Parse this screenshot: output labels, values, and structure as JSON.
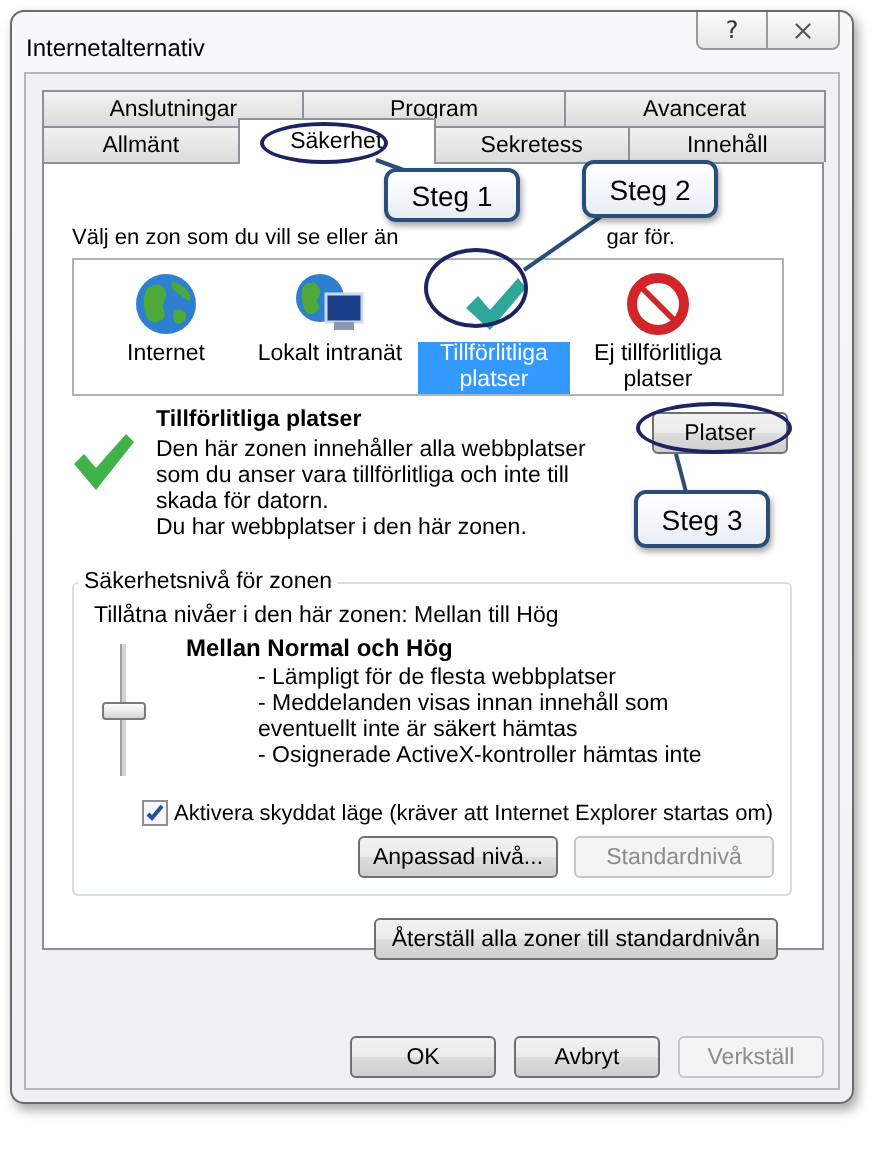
{
  "window": {
    "title": "Internetalternativ",
    "help": "?"
  },
  "tab_rows": [
    {
      "tabs": [
        {
          "label": "Anslutningar",
          "selected": false
        },
        {
          "label": "Program",
          "selected": false
        },
        {
          "label": "Avancerat",
          "selected": false
        }
      ]
    },
    {
      "tabs": [
        {
          "label": "Allmänt",
          "selected": false
        },
        {
          "label": "Säkerhet",
          "selected": true
        },
        {
          "label": "Sekretess",
          "selected": false
        },
        {
          "label": "Innehåll",
          "selected": false
        }
      ]
    }
  ],
  "instruction": {
    "before": "Välj en zon som du vill se eller än",
    "after": "gar för."
  },
  "zones": [
    {
      "kind": "globe",
      "label": "Internet",
      "selected": false
    },
    {
      "kind": "intranet",
      "label": "Lokalt intranät",
      "selected": false
    },
    {
      "kind": "trusted",
      "label": "Tillförlitliga platser",
      "selected": true
    },
    {
      "kind": "blocked",
      "label": "Ej tillförlitliga platser",
      "selected": false
    }
  ],
  "zone_info": {
    "title": "Tillförlitliga platser",
    "description": "Den här zonen innehåller alla webbplatser som du anser vara tillförlitliga och inte till skada för datorn.",
    "note": "Du har webbplatser i den här zonen.",
    "button": "Platser"
  },
  "security_level": {
    "legend": "Säkerhetsnivå för zonen",
    "allowed": "Tillåtna nivåer i den här zonen: Mellan till Hög",
    "slider": {
      "level": 0.5
    },
    "level_name": "Mellan Normal och Hög",
    "bullets": [
      "- Lämpligt för de flesta webbplatser",
      "- Meddelanden visas innan innehåll som eventuellt inte är säkert hämtas",
      "- Osignerade ActiveX-kontroller hämtas inte"
    ],
    "protected_mode": {
      "label": "Aktivera skyddat läge (kräver att Internet Explorer startas om)",
      "checked": true
    },
    "buttons": [
      {
        "label": "Anpassad nivå...",
        "disabled": false
      },
      {
        "label": "Standardnivå",
        "disabled": true
      }
    ]
  },
  "reset_button": "Återställ alla zoner till standardnivån",
  "dialog_buttons": [
    {
      "label": "OK",
      "disabled": false
    },
    {
      "label": "Avbryt",
      "disabled": false
    },
    {
      "label": "Verkställ",
      "disabled": true
    }
  ],
  "annotations": [
    "Steg 1",
    "Steg 2",
    "Steg 3"
  ]
}
